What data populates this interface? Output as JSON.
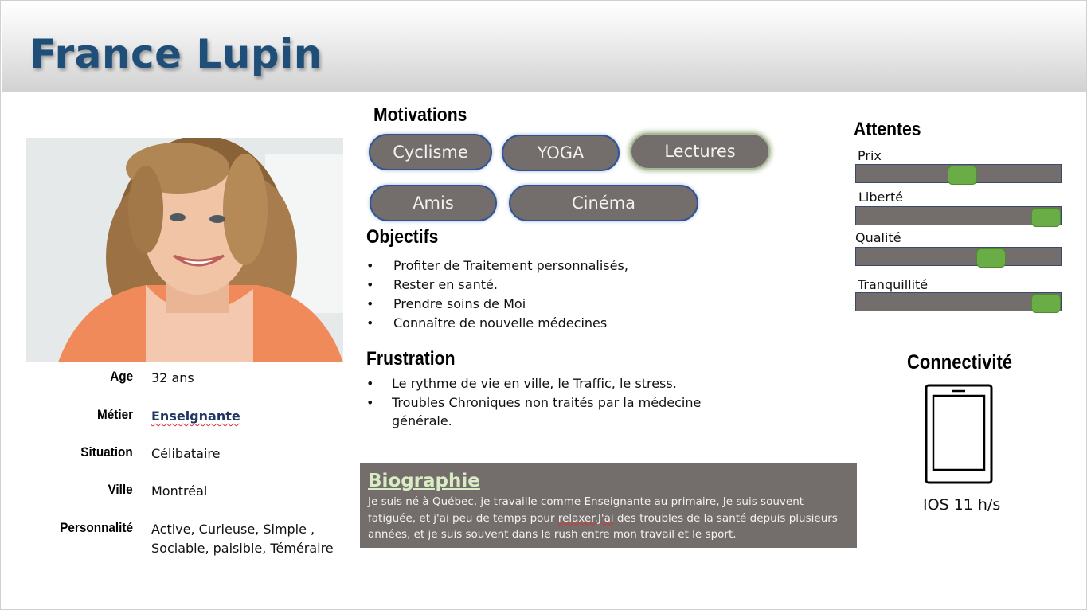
{
  "persona": {
    "name": "France Lupin"
  },
  "profile": [
    {
      "label": "Age",
      "value": "32 ans"
    },
    {
      "label": "Métier",
      "value": "Enseignante"
    },
    {
      "label": "Situation",
      "value": "Célibataire"
    },
    {
      "label": "Ville",
      "value": "Montréal"
    },
    {
      "label": "Personnalité",
      "value": "Active, Curieuse, Simple ,",
      "value2": "Sociable, paisible, Téméraire"
    }
  ],
  "motivations": {
    "title": "Motivations",
    "items": [
      "Cyclisme",
      "YOGA",
      "Lectures",
      "Amis",
      "Cinéma"
    ]
  },
  "objectifs": {
    "title": "Objectifs",
    "items": [
      "Profiter de Traitement personnalisés,",
      "Rester en santé.",
      "Prendre soins de Moi",
      "Connaître de nouvelle médecines"
    ]
  },
  "frustration": {
    "title": "Frustration",
    "items": [
      "Le rythme de vie en ville, le Traffic, le stress.",
      "Troubles Chroniques non traités par la médecine",
      "générale."
    ]
  },
  "biographie": {
    "title": "Biographie",
    "line1": "Je suis né à Québec, je travaille comme  Enseignante au primaire, Je suis souvent",
    "line2a": "fatiguée, et j'ai peu de temps pour ",
    "line2b": "relaxer.J'ai",
    "line2c": " des troubles de la santé depuis plusieurs",
    "line3": "années, et je suis souvent dans le rush entre mon travail et le sport."
  },
  "attentes": {
    "title": "Attentes",
    "items": [
      {
        "label": "Prix",
        "level": 0.52
      },
      {
        "label": "Liberté",
        "level": 0.97
      },
      {
        "label": "Qualité",
        "level": 0.66
      },
      {
        "label": "Tranquillité",
        "level": 0.97
      }
    ]
  },
  "connectivite": {
    "title": "Connectivité",
    "device_icon": "smartphone-icon",
    "usage": "IOS 11 h/s"
  },
  "colors": {
    "title": "#1f4e79",
    "pill_bg": "#736d6b",
    "slider_thumb": "#6aac45"
  }
}
